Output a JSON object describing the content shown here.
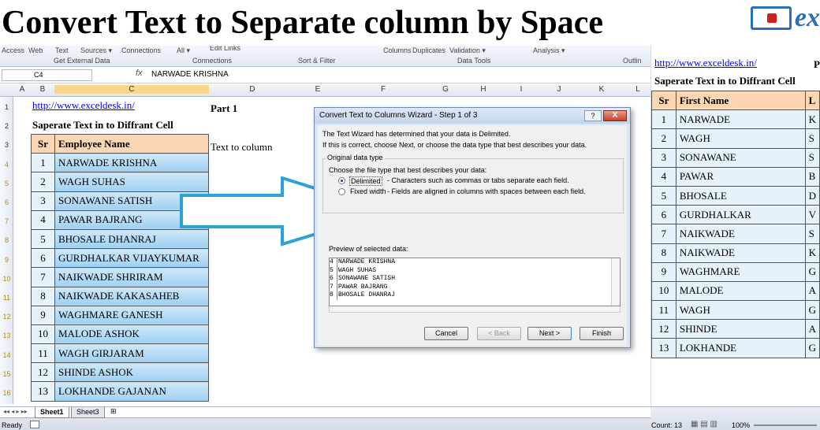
{
  "title": "Convert Text to Separate column by Space",
  "logo": "ex",
  "ribbon": {
    "items": [
      "Access",
      "Web",
      "Text",
      "Sources ▾",
      "Connections",
      "All ▾",
      "Edit Links",
      "Columns",
      "Duplicates",
      "Validation ▾",
      "Analysis ▾"
    ],
    "groups": [
      "Get External Data",
      "Connections",
      "Sort & Filter",
      "Data Tools",
      "Outlin"
    ]
  },
  "formula_bar": {
    "name_box": "C4",
    "fx": "fx",
    "value": "NARWADE KRISHNA"
  },
  "columns": [
    "A",
    "B",
    "C",
    "D",
    "E",
    "F",
    "G",
    "H",
    "I",
    "J",
    "K",
    "L"
  ],
  "rows": [
    "1",
    "2",
    "3",
    "4",
    "5",
    "6",
    "7",
    "8",
    "9",
    "10",
    "11",
    "12",
    "13",
    "14",
    "15",
    "16"
  ],
  "sheet": {
    "link": "http://www.exceldesk.in/",
    "part": "Part 1",
    "subtitle": "Saperate Text in to Diffrant Cell",
    "label": "Text to column",
    "table_header": [
      "Sr",
      "Employee Name"
    ],
    "table": [
      [
        "1",
        "NARWADE KRISHNA"
      ],
      [
        "2",
        "WAGH SUHAS"
      ],
      [
        "3",
        "SONAWANE SATISH"
      ],
      [
        "4",
        "PAWAR BAJRANG"
      ],
      [
        "5",
        "BHOSALE DHANRAJ"
      ],
      [
        "6",
        "GURDHALKAR VIJAYKUMAR"
      ],
      [
        "7",
        "NAIKWADE SHRIRAM"
      ],
      [
        "8",
        "NAIKWADE KAKASAHEB"
      ],
      [
        "9",
        "WAGHMARE GANESH"
      ],
      [
        "10",
        "MALODE ASHOK"
      ],
      [
        "11",
        "WAGH GIRJARAM"
      ],
      [
        "12",
        "SHINDE ASHOK"
      ],
      [
        "13",
        "LOKHANDE GAJANAN"
      ]
    ]
  },
  "dialog": {
    "title": "Convert Text to Columns Wizard - Step 1 of 3",
    "help": "?",
    "close": "X",
    "line1": "The Text Wizard has determined that your data is Delimited.",
    "line2": "If this is correct, choose Next, or choose the data type that best describes your data.",
    "group": "Original data type",
    "choose": "Choose the file type that best describes your data:",
    "opt1": "Delimited",
    "opt1_desc": "- Characters such as commas or tabs separate each field.",
    "opt2": "Fixed width",
    "opt2_desc": "- Fields are aligned in columns with spaces between each field.",
    "preview_label": "Preview of selected data:",
    "preview": [
      [
        "4",
        "NARWADE KRISHNA"
      ],
      [
        "5",
        "WAGH SUHAS"
      ],
      [
        "6",
        "SONAWANE SATISH"
      ],
      [
        "7",
        "PAWAR BAJRANG"
      ],
      [
        "8",
        "BHOSALE DHANRAJ"
      ]
    ],
    "buttons": {
      "cancel": "Cancel",
      "back": "< Back",
      "next": "Next >",
      "finish": "Finish"
    }
  },
  "right": {
    "link": "http://www.exceldesk.in/",
    "p": "P",
    "subtitle": "Saperate Text in to Diffrant Cell",
    "header": [
      "Sr",
      "First Name",
      "L"
    ],
    "rows": [
      [
        "1",
        "NARWADE",
        "K"
      ],
      [
        "2",
        "WAGH",
        "S"
      ],
      [
        "3",
        "SONAWANE",
        "S"
      ],
      [
        "4",
        "PAWAR",
        "B"
      ],
      [
        "5",
        "BHOSALE",
        "D"
      ],
      [
        "6",
        "GURDHALKAR",
        "V"
      ],
      [
        "7",
        "NAIKWADE",
        "S"
      ],
      [
        "8",
        "NAIKWADE",
        "K"
      ],
      [
        "9",
        "WAGHMARE",
        "G"
      ],
      [
        "10",
        "MALODE",
        "A"
      ],
      [
        "11",
        "WAGH",
        "G"
      ],
      [
        "12",
        "SHINDE",
        "A"
      ],
      [
        "13",
        "LOKHANDE",
        "G"
      ]
    ]
  },
  "status": {
    "ready": "Ready",
    "tab1": "Sheet1",
    "tab2": "Sheet3",
    "count": "Count: 13",
    "zoom": "100%"
  }
}
